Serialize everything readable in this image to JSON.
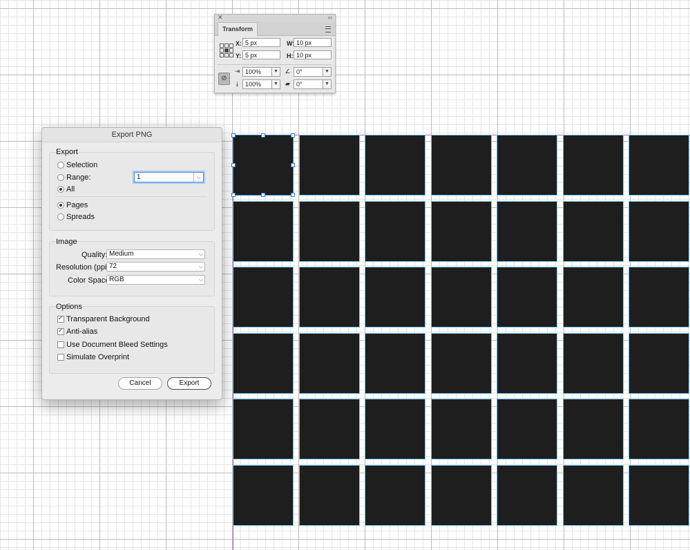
{
  "transform_panel": {
    "tab": "Transform",
    "x_label": "X:",
    "x_value": "5 px",
    "y_label": "Y:",
    "y_value": "5 px",
    "w_label": "W:",
    "w_value": "10 px",
    "h_label": "H:",
    "h_value": "10 px",
    "scale_x": "100%",
    "scale_y": "100%",
    "rotation": "0°",
    "shear": "0°"
  },
  "export_dialog": {
    "title": "Export PNG",
    "export_group": {
      "label": "Export",
      "selection": "Selection",
      "range": "Range:",
      "range_value": "1",
      "all": "All",
      "pages": "Pages",
      "spreads": "Spreads",
      "selected_scope": "All",
      "selected_layout": "Pages"
    },
    "image_group": {
      "label": "Image",
      "quality_label": "Quality:",
      "quality_value": "Medium",
      "resolution_label": "Resolution (ppi):",
      "resolution_value": "72",
      "color_space_label": "Color Space:",
      "color_space_value": "RGB"
    },
    "options_group": {
      "label": "Options",
      "items": [
        {
          "label": "Transparent Background",
          "checked": true
        },
        {
          "label": "Anti-alias",
          "checked": true
        },
        {
          "label": "Use Document Bleed Settings",
          "checked": false
        },
        {
          "label": "Simulate Overprint",
          "checked": false
        }
      ]
    },
    "cancel": "Cancel",
    "export": "Export"
  },
  "colors": {
    "tile": "#1e1e1e",
    "page_edge": "#c25bd1",
    "guide": "#6cc4f0",
    "selection": "#2f7fd4"
  }
}
